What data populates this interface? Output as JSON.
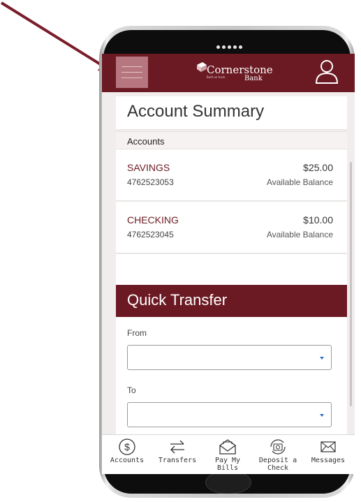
{
  "header": {
    "brand_name": "Cornerstone",
    "brand_sub": "Bank",
    "brand_tagline": "Built on trust.",
    "icons": {
      "menu": "hamburger-menu-icon",
      "profile": "user-profile-icon"
    }
  },
  "page": {
    "title": "Account Summary"
  },
  "accounts": {
    "header": "Accounts",
    "items": [
      {
        "name": "SAVINGS",
        "number": "4762523053",
        "balance": "$25.00",
        "balance_label": "Available Balance"
      },
      {
        "name": "CHECKING",
        "number": "4762523045",
        "balance": "$10.00",
        "balance_label": "Available Balance"
      }
    ]
  },
  "quick_transfer": {
    "title": "Quick Transfer",
    "from_label": "From",
    "from_value": "",
    "to_label": "To",
    "to_value": ""
  },
  "tabs": [
    {
      "label": "Accounts",
      "icon": "dollar-circle-icon"
    },
    {
      "label": "Transfers",
      "icon": "transfer-arrows-icon"
    },
    {
      "label": "Pay My\nBills",
      "icon": "bill-envelope-icon"
    },
    {
      "label": "Deposit a\nCheck",
      "icon": "camera-deposit-icon"
    },
    {
      "label": "Messages",
      "icon": "mail-icon"
    }
  ],
  "colors": {
    "brand": "#6b1a23",
    "menu_highlight": "#b5767f",
    "link": "#6b1a23",
    "arrow": "#7a1d2a"
  }
}
